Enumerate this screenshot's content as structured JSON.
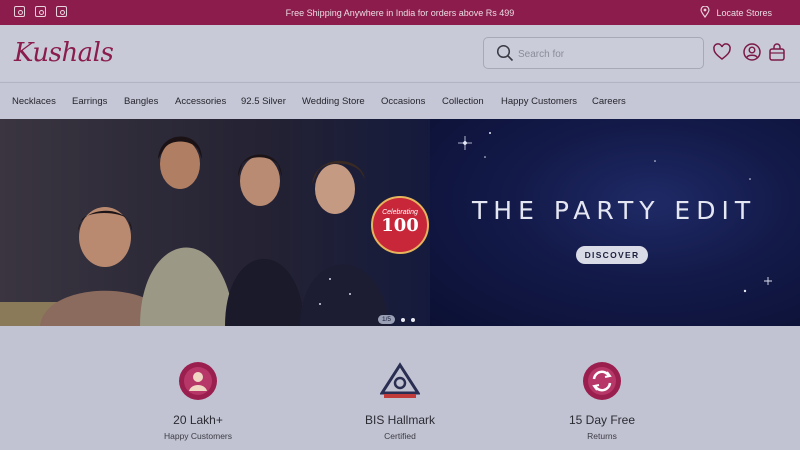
{
  "topbar": {
    "promo": "Free Shipping Anywhere in India for orders above Rs 499",
    "locate": "Locate Stores",
    "social_icons": [
      "facebook-icon",
      "instagram-icon",
      "pinterest-icon"
    ]
  },
  "header": {
    "logo": "Kushals",
    "search_placeholder": "Search for",
    "icons": [
      "wishlist-heart-icon",
      "account-user-icon",
      "shopping-bag-icon"
    ]
  },
  "nav": {
    "items": [
      "Necklaces",
      "Earrings",
      "Bangles",
      "Accessories",
      "92.5 Silver",
      "Wedding Store",
      "Occasions",
      "Collection",
      "Happy Customers",
      "Careers"
    ]
  },
  "hero": {
    "headline": "THE PARTY EDIT",
    "cta": "DISCOVER",
    "badge_small": "Celebrating",
    "badge_number": "100",
    "pager": "1/5"
  },
  "features": [
    {
      "title": "20 Lakh+",
      "subtitle": "Happy Customers",
      "icon": "happy-customer-icon"
    },
    {
      "title": "BIS Hallmark",
      "subtitle": "Certified",
      "icon": "bis-hallmark-icon"
    },
    {
      "title": "15 Day Free",
      "subtitle": "Returns",
      "icon": "returns-icon"
    }
  ],
  "colors": {
    "brand": "#8c1c4b",
    "hero_bg": "#0e1333",
    "page_bg": "#c6c7d6"
  }
}
